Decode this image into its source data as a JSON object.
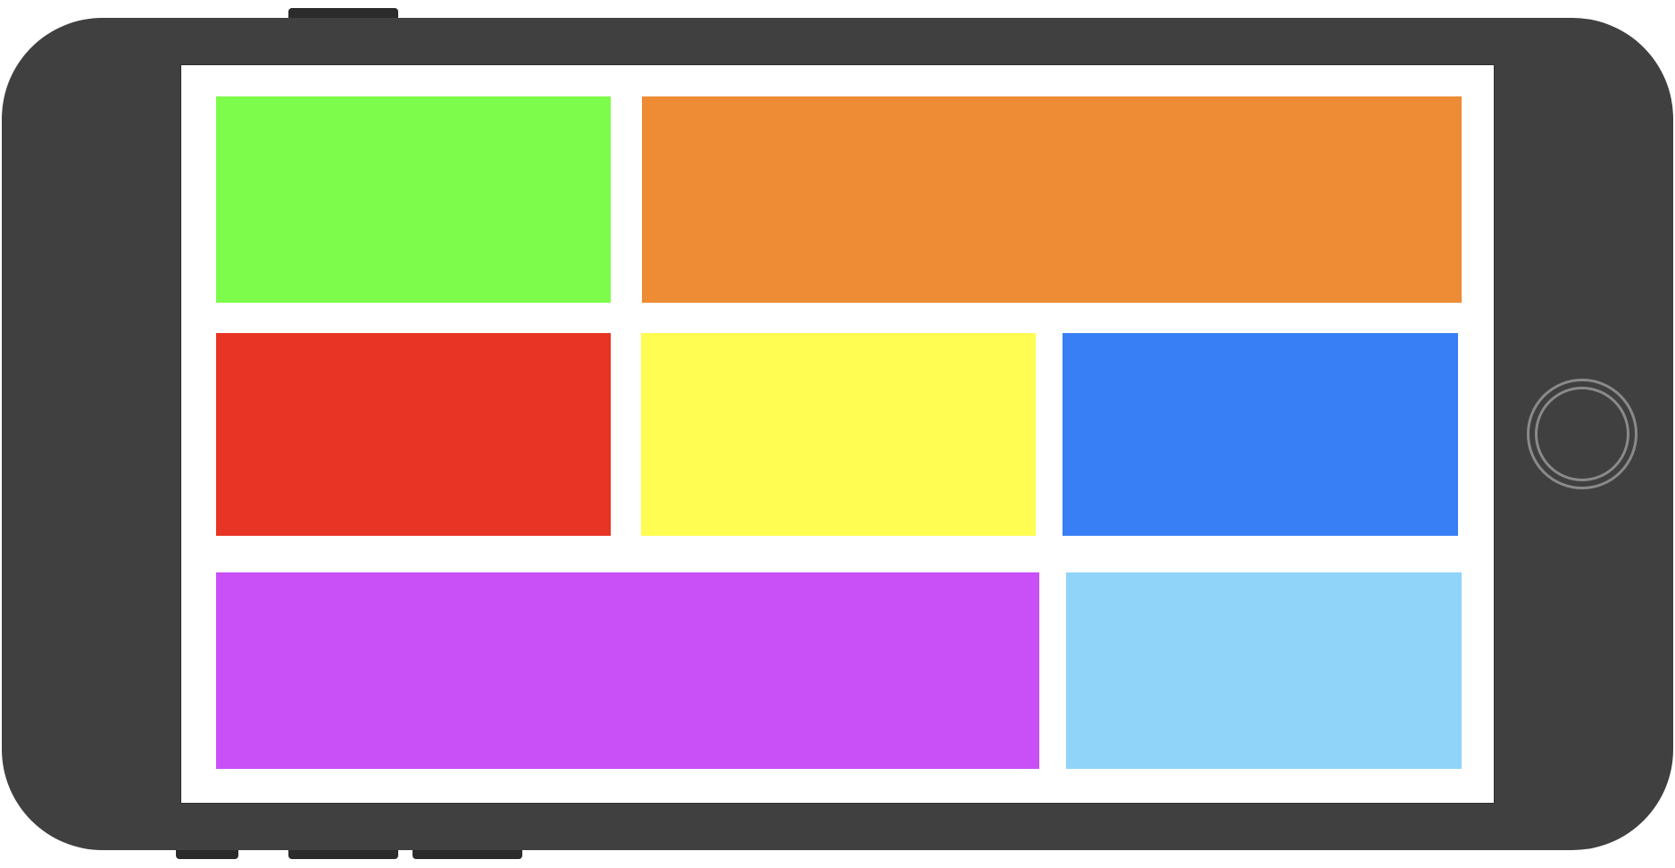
{
  "device": {
    "orientation": "landscape",
    "body_color": "#404040",
    "screen_color": "#ffffff",
    "button_color": "#2b2b2b",
    "home_button_ring_color": "#8a8a8a"
  },
  "tiles": [
    {
      "name": "tile-green",
      "color": "#7efc4c"
    },
    {
      "name": "tile-orange",
      "color": "#ed8c35"
    },
    {
      "name": "tile-red",
      "color": "#e73424"
    },
    {
      "name": "tile-yellow",
      "color": "#fffd51"
    },
    {
      "name": "tile-blue",
      "color": "#387ff5"
    },
    {
      "name": "tile-purple",
      "color": "#c94ff7"
    },
    {
      "name": "tile-light-blue",
      "color": "#91d4fa"
    }
  ]
}
